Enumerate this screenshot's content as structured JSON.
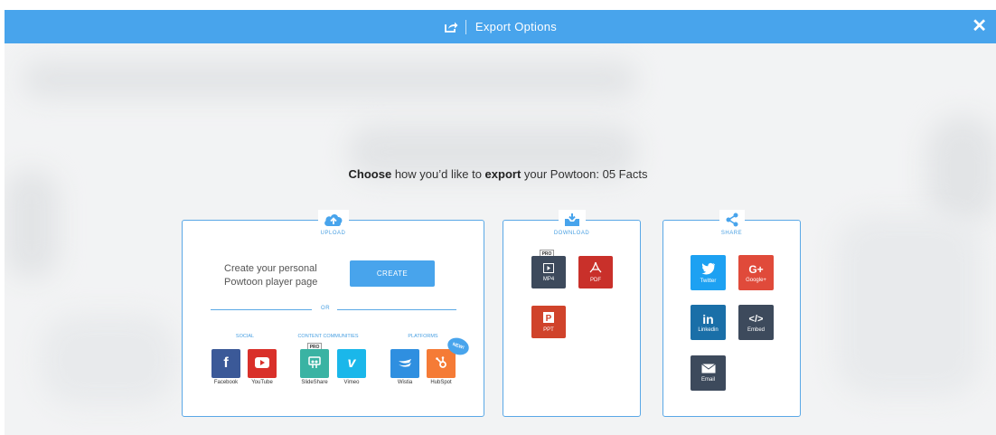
{
  "header": {
    "title": "Export Options",
    "close_label": "✕"
  },
  "intro": {
    "choose": "Choose",
    "text1": " how you’d like to ",
    "export": "export",
    "text2": " your Powtoon: 05 Facts"
  },
  "upload": {
    "caption": "UPLOAD",
    "create_text_line1": "Create your personal",
    "create_text_line2": "Powtoon player page",
    "create_button": "CREATE",
    "or_label": "OR",
    "categories": {
      "social": "SOCIAL",
      "communities": "CONTENT COMMUNITIES",
      "platforms": "PLATFORMS"
    },
    "tiles": {
      "facebook": "Facebook",
      "youtube": "YouTube",
      "slideshare": "SlideShare",
      "vimeo": "Vimeo",
      "wistia": "Wistia",
      "hubspot": "HubSpot"
    },
    "pro_tag": "PRO",
    "new_badge": "NEW!"
  },
  "download": {
    "caption": "DOWNLOAD",
    "pro_tag": "PRO",
    "tiles": {
      "mp4": "MP4",
      "pdf": "PDF",
      "ppt": "PPT"
    }
  },
  "share": {
    "caption": "SHARE",
    "tiles": {
      "twitter": "Twitter",
      "google": "Google+",
      "linkedin": "Linkedin",
      "embed": "Embed",
      "email": "Email"
    }
  },
  "colors": {
    "header_blue": "#48a4ec",
    "facebook": "#3b5998",
    "youtube": "#d9302a",
    "slideshare": "#3ab3a3",
    "vimeo": "#1ab7ea",
    "wistia": "#2f8fe0",
    "hubspot": "#f57b36",
    "mp4": "#3d4a5c",
    "pdf": "#c9302a",
    "ppt": "#d0432b",
    "twitter": "#1da1f2",
    "google": "#e04a3a",
    "linkedin": "#1a6fa8",
    "embed": "#3d4a5c",
    "email": "#3d4a5c"
  }
}
